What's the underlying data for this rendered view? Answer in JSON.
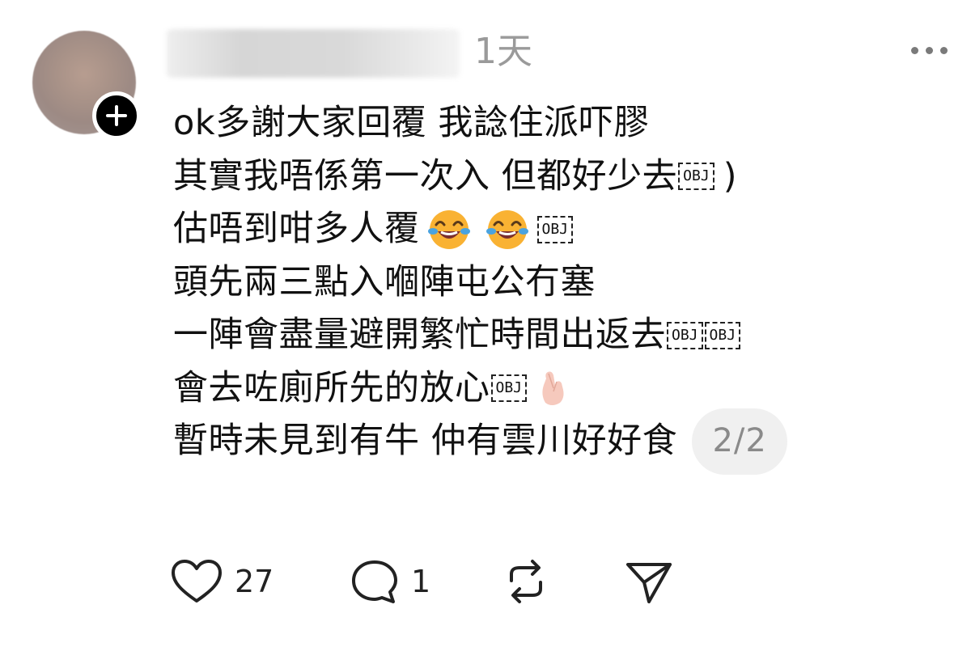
{
  "post": {
    "timestamp": "1天",
    "lines": [
      "ok多謝大家回覆 我諗住派吓膠",
      "其實我唔係第一次入 但都好少去",
      "估唔到咁多人覆",
      "頭先兩三點入嗰陣屯公冇塞",
      "一陣會盡量避開繁忙時間出返去",
      "會去咗廁所先的放心",
      "暫時未見到有牛 仲有雲川好好食"
    ],
    "line2_suffix": ")",
    "obj_marker": "OBJ",
    "page_indicator": "2/2"
  },
  "icons": {
    "avatar": "avatar-blurred",
    "follow": "plus-icon",
    "more": "more-horizontal-icon",
    "emoji_laugh": "face-with-tears-of-joy-emoji",
    "emoji_hand": "hand-with-index-finger-and-thumb-crossed-emoji"
  },
  "actions": {
    "likes": "27",
    "replies": "1"
  },
  "colors": {
    "text": "#111111",
    "muted": "#9a9a9a",
    "icon": "#222222",
    "pill_bg": "#f0f0f0"
  }
}
